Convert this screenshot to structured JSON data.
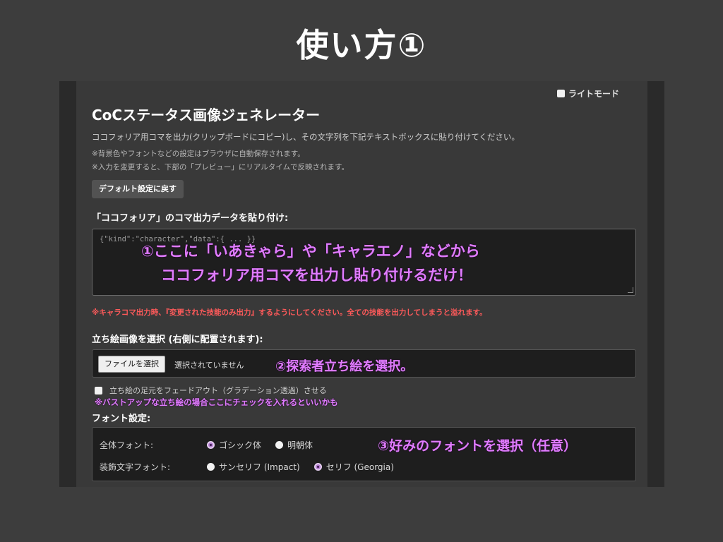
{
  "slide_title": "使い方①",
  "light_mode_label": "ライトモード",
  "app_title": "CoCステータス画像ジェネレーター",
  "description": "ココフォリア用コマを出力(クリップボードにコピー)し、その文字列を下記テキストボックスに貼り付けてください。",
  "notes": [
    "※背景色やフォントなどの設定はブラウザに自動保存されます。",
    "※入力を変更すると、下部の「プレビュー」にリアルタイムで反映されます。"
  ],
  "default_button": "デフォルト設定に戻す",
  "paste_label": "「ココフォリア」のコマ出力データを貼り付け:",
  "paste_placeholder": "{\"kind\":\"character\",\"data\":{ ... }}",
  "warning": "※キャラコマ出力時、『変更された技能のみ出力』するようにしてください。全ての技能を出力してしまうと溢れます。",
  "image_label": "立ち絵画像を選択 (右側に配置されます):",
  "file_button": "ファイルを選択",
  "file_status": "選択されていません",
  "fade_label": "立ち絵の足元をフェードアウト（グラデーション透過）させる",
  "font_label": "フォント設定:",
  "font_settings": {
    "body_font_label": "全体フォント:",
    "body_options": [
      "ゴシック体",
      "明朝体"
    ],
    "deco_font_label": "装飾文字フォント:",
    "deco_options": [
      "サンセリフ (Impact)",
      "セリフ (Georgia)"
    ]
  },
  "overlays": {
    "step1_line1": "①ここに「いあきゃら」や「キャラエノ」などから",
    "step1_line2": "ココフォリア用コマを出力し貼り付けるだけ！",
    "step2": "②探索者立ち絵を選択。",
    "fade_hint": "※バストアップな立ち絵の場合ここにチェックを入れるといいかも",
    "step3": "③好みのフォントを選択（任意）"
  },
  "colors": {
    "accent_overlay": "#e07cff",
    "warning": "#ff5a5a",
    "radio_selected": "#b27ccf"
  }
}
